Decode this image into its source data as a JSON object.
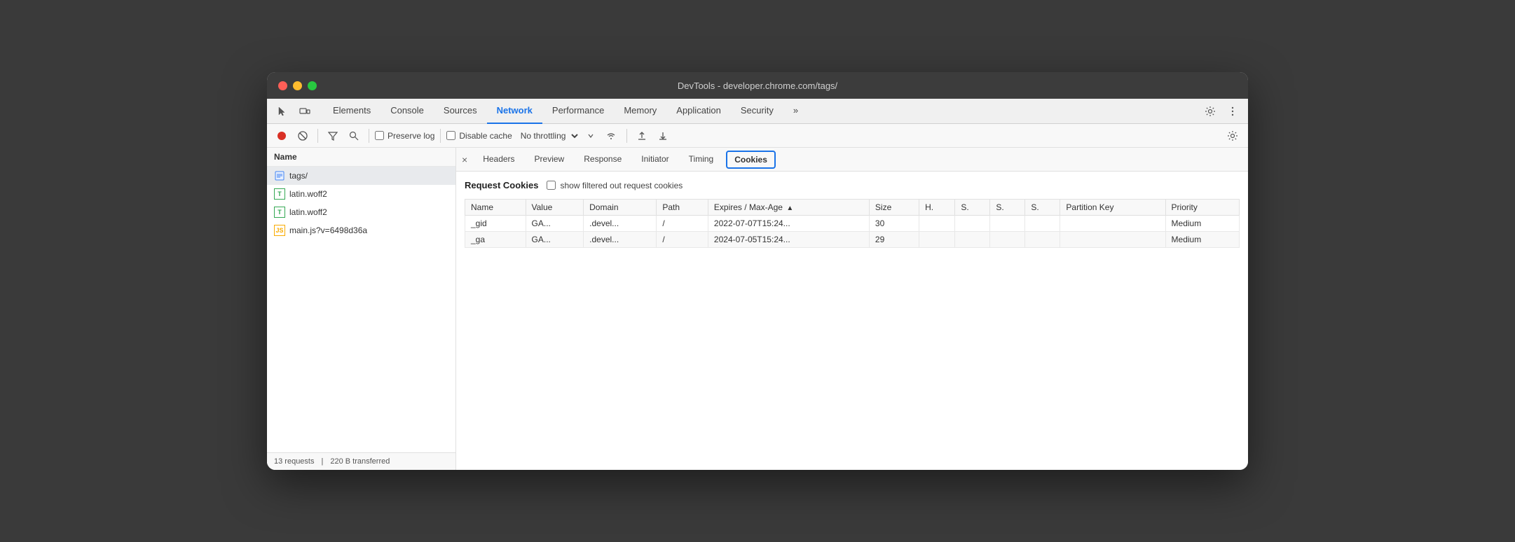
{
  "window": {
    "title": "DevTools - developer.chrome.com/tags/"
  },
  "traffic_lights": {
    "close": "close",
    "minimize": "minimize",
    "maximize": "maximize"
  },
  "main_tabs": {
    "items": [
      {
        "label": "Elements",
        "active": false
      },
      {
        "label": "Console",
        "active": false
      },
      {
        "label": "Sources",
        "active": false
      },
      {
        "label": "Network",
        "active": true
      },
      {
        "label": "Performance",
        "active": false
      },
      {
        "label": "Memory",
        "active": false
      },
      {
        "label": "Application",
        "active": false
      },
      {
        "label": "Security",
        "active": false
      },
      {
        "label": "»",
        "active": false
      }
    ]
  },
  "toolbar": {
    "preserve_log": "Preserve log",
    "disable_cache": "Disable cache",
    "throttling": "No throttling"
  },
  "sidebar": {
    "header": "Name",
    "items": [
      {
        "label": "tags/",
        "icon": "doc",
        "selected": true
      },
      {
        "label": "latin.woff2",
        "icon": "font"
      },
      {
        "label": "latin.woff2",
        "icon": "font"
      },
      {
        "label": "main.js?v=6498d36a",
        "icon": "js"
      }
    ],
    "footer": {
      "requests": "13 requests",
      "transferred": "220 B transferred"
    }
  },
  "detail_tabs": {
    "items": [
      {
        "label": "Headers"
      },
      {
        "label": "Preview"
      },
      {
        "label": "Response"
      },
      {
        "label": "Initiator"
      },
      {
        "label": "Timing"
      },
      {
        "label": "Cookies",
        "highlighted": true
      }
    ]
  },
  "cookies_section": {
    "title": "Request Cookies",
    "filter_label": "show filtered out request cookies",
    "table": {
      "headers": [
        {
          "label": "Name",
          "sortable": false
        },
        {
          "label": "Value",
          "sortable": false
        },
        {
          "label": "Domain",
          "sortable": false
        },
        {
          "label": "Path",
          "sortable": false
        },
        {
          "label": "Expires / Max-Age",
          "sortable": true,
          "sort_dir": "asc"
        },
        {
          "label": "Size",
          "sortable": false
        },
        {
          "label": "H.",
          "sortable": false
        },
        {
          "label": "S.",
          "sortable": false
        },
        {
          "label": "S.",
          "sortable": false
        },
        {
          "label": "S.",
          "sortable": false
        },
        {
          "label": "Partition Key",
          "sortable": false
        },
        {
          "label": "Priority",
          "sortable": false
        }
      ],
      "rows": [
        {
          "name": "_gid",
          "value": "GA...",
          "domain": ".devel...",
          "path": "/",
          "expires": "2022-07-07T15:24...",
          "size": "30",
          "h": "",
          "s1": "",
          "s2": "",
          "s3": "",
          "partition_key": "",
          "priority": "Medium"
        },
        {
          "name": "_ga",
          "value": "GA...",
          "domain": ".devel...",
          "path": "/",
          "expires": "2024-07-05T15:24...",
          "size": "29",
          "h": "",
          "s1": "",
          "s2": "",
          "s3": "",
          "partition_key": "",
          "priority": "Medium"
        }
      ]
    }
  }
}
